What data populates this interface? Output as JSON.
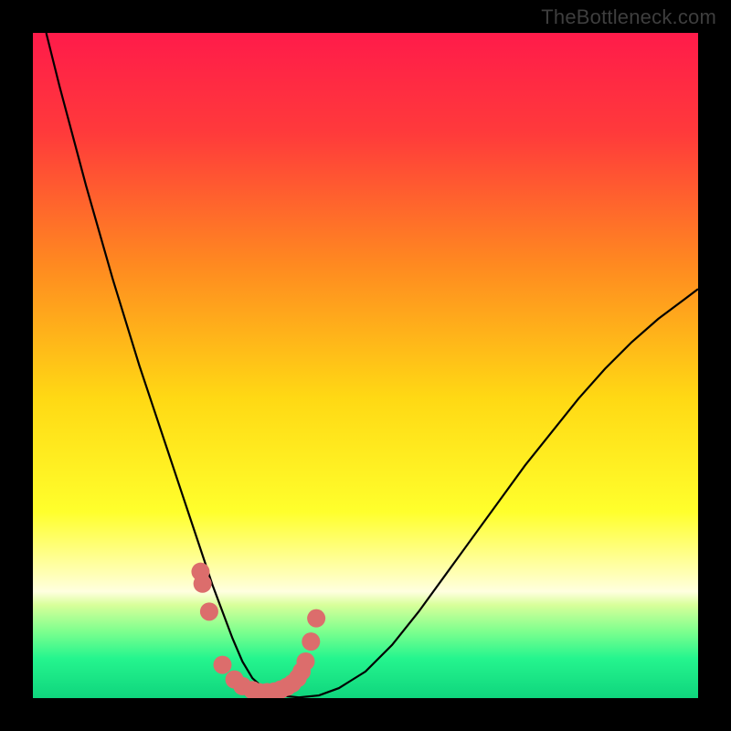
{
  "watermark": "TheBottleneck.com",
  "chart_data": {
    "type": "line",
    "title": "",
    "xlabel": "",
    "ylabel": "",
    "xlim": [
      0,
      100
    ],
    "ylim": [
      0,
      100
    ],
    "gradient_stops": [
      {
        "offset": 0,
        "color": "#ff1b4a"
      },
      {
        "offset": 15,
        "color": "#ff3a3b"
      },
      {
        "offset": 35,
        "color": "#ff8a20"
      },
      {
        "offset": 55,
        "color": "#ffd914"
      },
      {
        "offset": 72,
        "color": "#ffff2c"
      },
      {
        "offset": 81,
        "color": "#ffffb0"
      },
      {
        "offset": 84,
        "color": "#ffffe0"
      },
      {
        "offset": 86,
        "color": "#d8ff9a"
      },
      {
        "offset": 90,
        "color": "#7dff8e"
      },
      {
        "offset": 94,
        "color": "#25f58e"
      },
      {
        "offset": 100,
        "color": "#0fd57d"
      }
    ],
    "series": [
      {
        "name": "curve",
        "type": "line",
        "x": [
          2,
          4,
          6,
          8,
          10,
          12,
          14,
          16,
          18,
          20,
          22,
          24,
          25.5,
          27,
          28.5,
          30,
          31.5,
          33,
          35,
          37,
          40,
          43,
          46,
          50,
          54,
          58,
          62,
          66,
          70,
          74,
          78,
          82,
          86,
          90,
          94,
          98,
          100
        ],
        "y": [
          100,
          92,
          84.5,
          77,
          70,
          63,
          56.5,
          50,
          44,
          38,
          32,
          26,
          21.5,
          17,
          13,
          9,
          5.5,
          3,
          1.2,
          0.4,
          0.1,
          0.4,
          1.5,
          4,
          8,
          13,
          18.5,
          24,
          29.5,
          35,
          40,
          45,
          49.5,
          53.5,
          57,
          60,
          61.5
        ]
      },
      {
        "name": "markers",
        "type": "scatter",
        "x": [
          25.2,
          25.5,
          26.5,
          28.5,
          30.3,
          31.5,
          33.0,
          34.0,
          35.2,
          36.3,
          37.3,
          38.2,
          39.0,
          39.8,
          40.4,
          41.0,
          41.8,
          42.6
        ],
        "y": [
          19.0,
          17.2,
          13.0,
          5.0,
          2.8,
          1.8,
          1.2,
          0.9,
          0.9,
          1.0,
          1.3,
          1.7,
          2.2,
          3.0,
          4.0,
          5.5,
          8.5,
          12.0
        ],
        "color": "#dc6d6c",
        "radius": 10
      }
    ]
  }
}
